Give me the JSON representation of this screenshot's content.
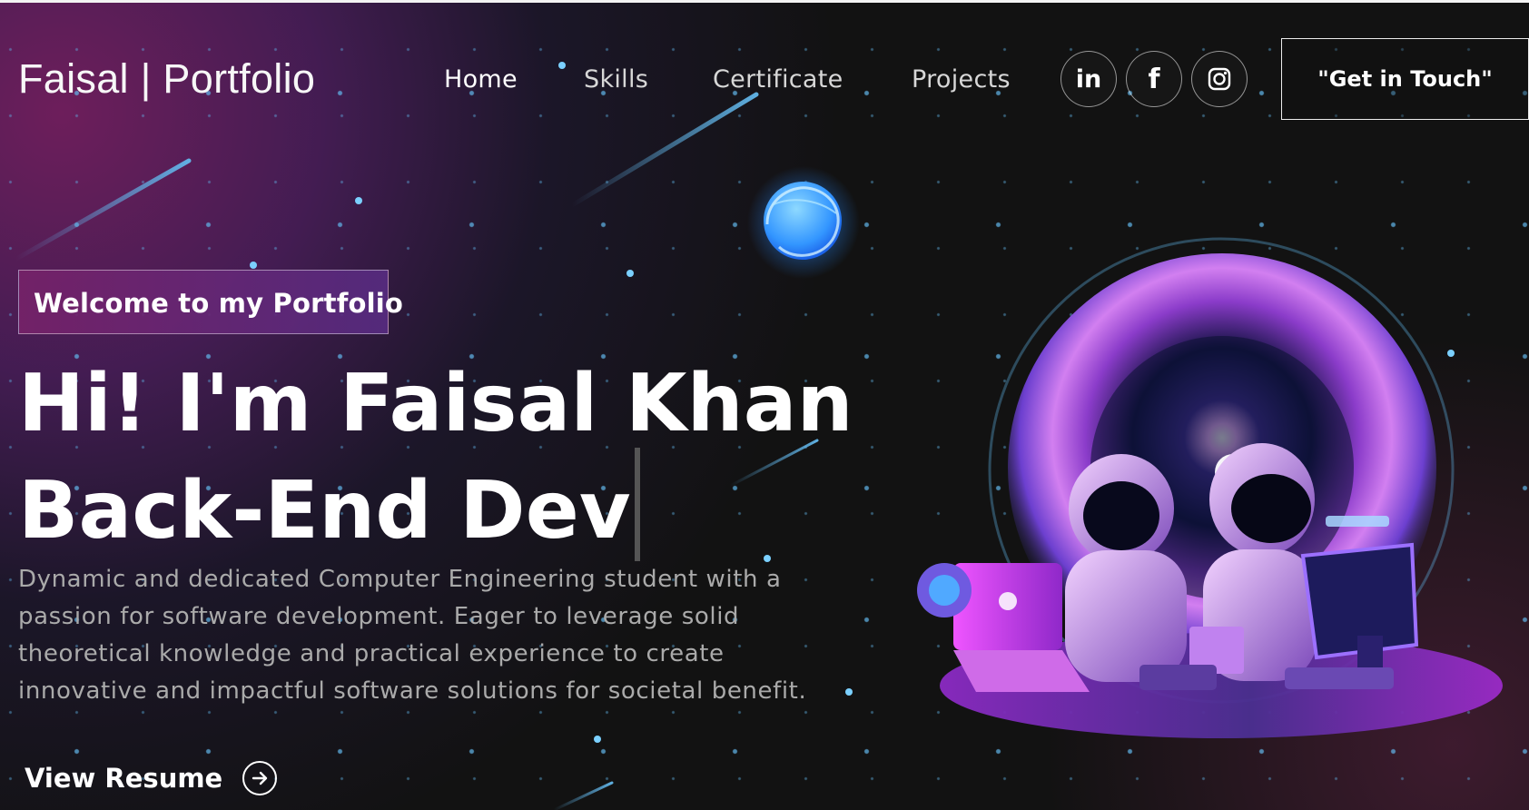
{
  "brand": {
    "text": "Faisal | Portfolio"
  },
  "nav": {
    "items": [
      {
        "label": "Home"
      },
      {
        "label": "Skills"
      },
      {
        "label": "Certificate"
      },
      {
        "label": "Projects"
      }
    ],
    "social": [
      {
        "icon": "linkedin-icon",
        "label": "in"
      },
      {
        "icon": "facebook-icon",
        "label": "f"
      },
      {
        "icon": "instagram-icon",
        "label": ""
      }
    ],
    "cta_label": "\"Get in Touch\""
  },
  "hero": {
    "badge": "Welcome to my Portfolio",
    "headline_line1": "Hi! I'm Faisal Khan",
    "headline_line2": "Back-End Dev",
    "description": "Dynamic and dedicated Computer Engineering student with a passion for software development. Eager to leverage solid theoretical knowledge and practical experience to create innovative and impactful software solutions for societal benefit.",
    "resume_label": "View Resume"
  },
  "colors": {
    "background": "#121212",
    "purple": "#8e3bbf",
    "blue": "#62b7eb",
    "text": "#ffffff",
    "muted": "#aaaaaa"
  }
}
